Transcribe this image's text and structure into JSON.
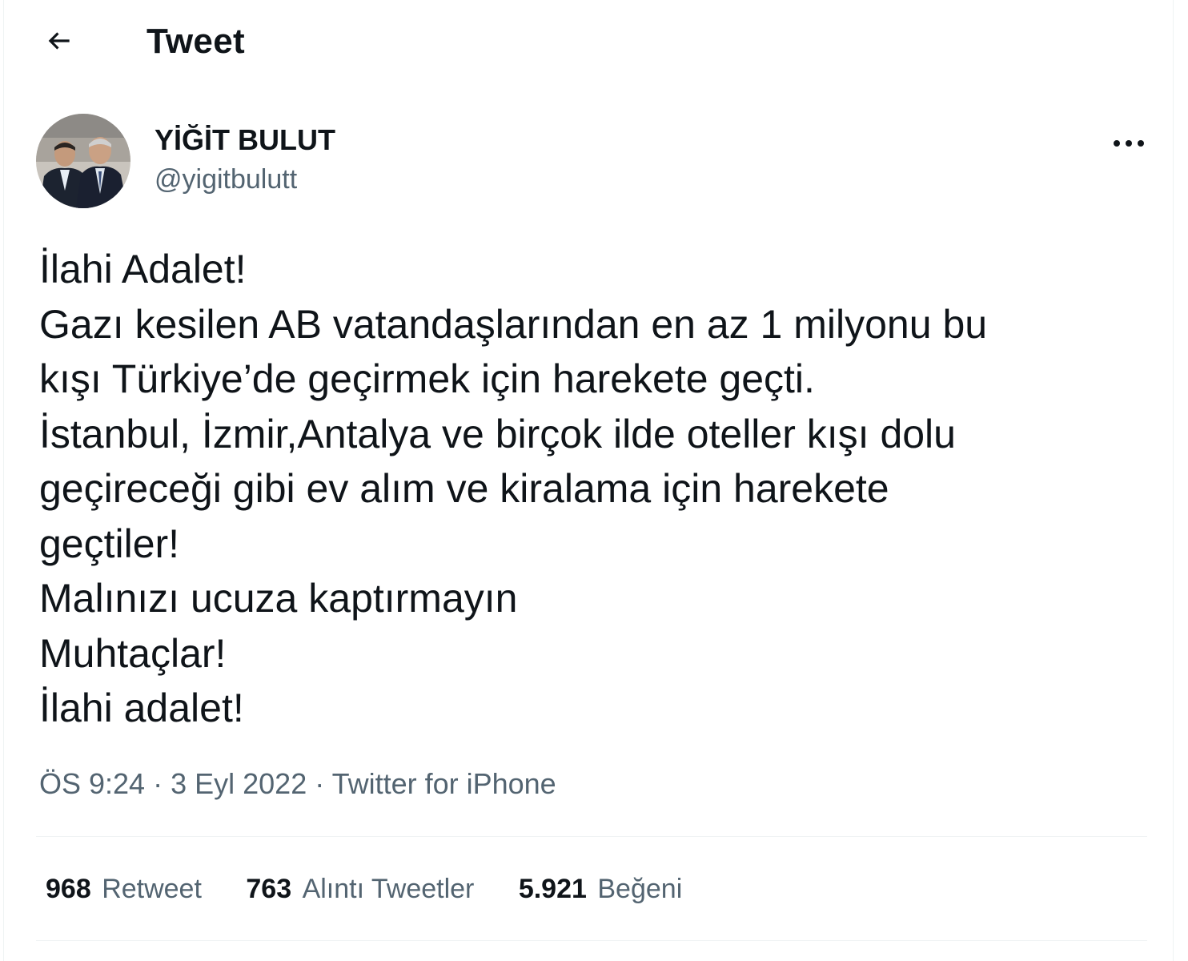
{
  "header": {
    "title": "Tweet"
  },
  "author": {
    "name": "YİĞİT BULUT",
    "handle": "@yigitbulutt"
  },
  "tweet": {
    "lines": [
      "İlahi Adalet!",
      "Gazı kesilen AB vatandaşlarından en az 1 milyonu bu",
      "kışı Türkiye’de geçirmek için harekete geçti.",
      "İstanbul, İzmir,Antalya ve birçok ilde oteller kışı dolu",
      "geçireceği gibi ev alım ve kiralama için harekete",
      "geçtiler!",
      "Malınızı ucuza kaptırmayın",
      "Muhtaçlar!",
      "İlahi adalet!"
    ]
  },
  "meta": {
    "time": "ÖS 9:24",
    "separator": " · ",
    "date": "3 Eyl 2022",
    "source": "Twitter for iPhone"
  },
  "stats": {
    "retweets": {
      "count": "968",
      "label": "Retweet"
    },
    "quotes": {
      "count": "763",
      "label": "Alıntı Tweetler"
    },
    "likes": {
      "count": "5.921",
      "label": "Beğeni"
    }
  },
  "icons": {
    "back": "arrow-left-icon",
    "more": "more-horizontal-icon"
  },
  "colors": {
    "text": "#0f1419",
    "secondary": "#536471",
    "divider": "#eff3f4"
  }
}
